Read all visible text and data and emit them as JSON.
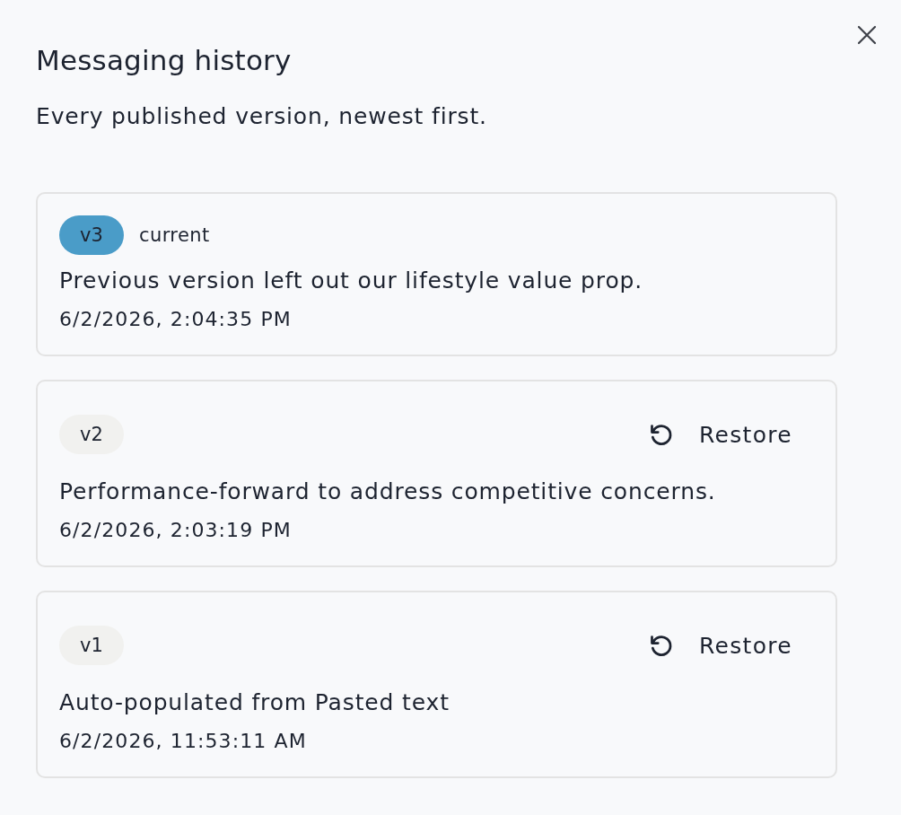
{
  "dialog": {
    "title": "Messaging history",
    "subtitle": "Every published version, newest first."
  },
  "versions": [
    {
      "version": "v3",
      "current": true,
      "status_label": "current",
      "note": "Previous version left out our lifestyle value prop.",
      "timestamp": "6/2/2026, 2:04:35 PM"
    },
    {
      "version": "v2",
      "current": false,
      "restore_button": "Restore",
      "note": "Performance-forward to address competitive concerns.",
      "timestamp": "6/2/2026, 2:03:19 PM"
    },
    {
      "version": "v1",
      "current": false,
      "restore_button": "Restore",
      "note": "Auto-populated from Pasted text",
      "timestamp": "6/2/2026, 11:53:11 AM"
    }
  ]
}
